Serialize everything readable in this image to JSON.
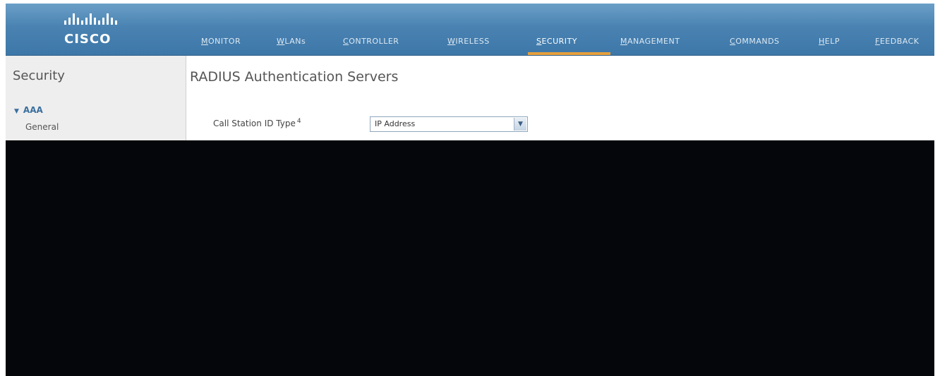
{
  "brand": {
    "name": "CISCO"
  },
  "nav": {
    "items": [
      {
        "label": "MONITOR",
        "active": false
      },
      {
        "label": "WLANs",
        "active": false
      },
      {
        "label": "CONTROLLER",
        "active": false
      },
      {
        "label": "WIRELESS",
        "active": false
      },
      {
        "label": "SECURITY",
        "active": true
      },
      {
        "label": "MANAGEMENT",
        "active": false
      },
      {
        "label": "COMMANDS",
        "active": false
      },
      {
        "label": "HELP",
        "active": false
      },
      {
        "label": "FEEDBACK",
        "active": false
      }
    ]
  },
  "sidebar": {
    "title": "Security",
    "group": {
      "label": "AAA"
    },
    "items": [
      {
        "label": "General"
      }
    ]
  },
  "main": {
    "title": "RADIUS Authentication Servers",
    "call_station": {
      "label": "Call Station ID Type",
      "footnote": "4",
      "value": "IP Address"
    }
  },
  "colors": {
    "header_blue": "#4a83b2",
    "active_underline": "#e8a03c",
    "redaction": "#05060b"
  }
}
